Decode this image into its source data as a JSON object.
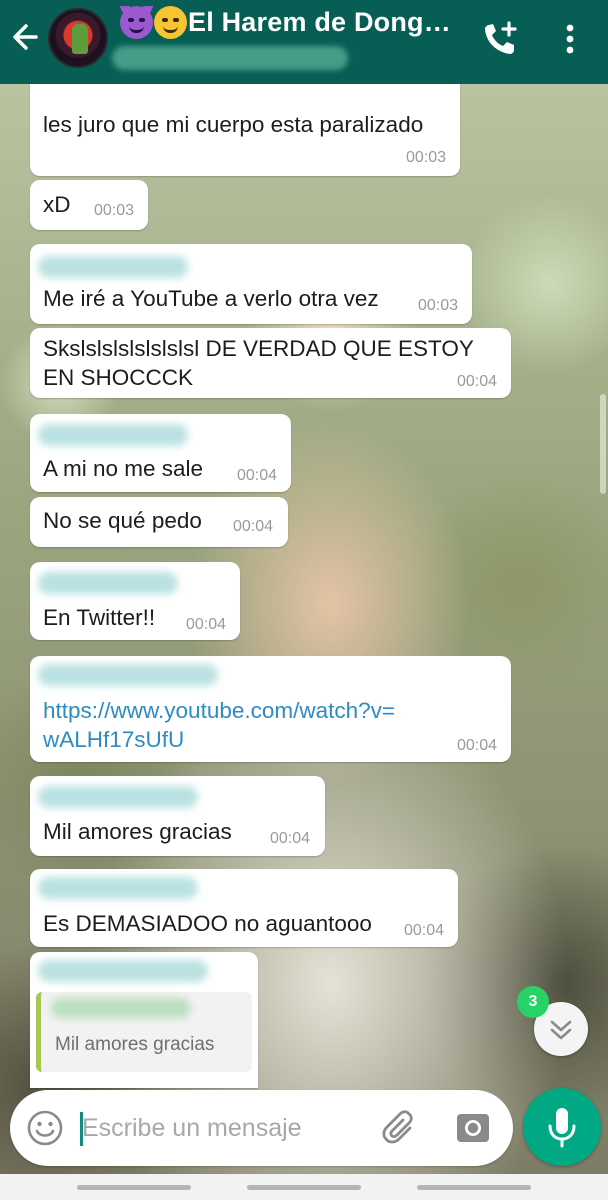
{
  "header": {
    "title": "El Harem de Dong…",
    "title_emojis": [
      "smiling-devil-emoji",
      "drooling-face-emoji"
    ],
    "background_color": "#075e54"
  },
  "messages": [
    {
      "text": "les juro que mi cuerpo esta paralizado",
      "time": "00:03"
    },
    {
      "text": "xD",
      "time": "00:03"
    },
    {
      "text": "Me iré a YouTube a verlo otra vez",
      "time": "00:03"
    },
    {
      "text": "Skslslslslslslslsl DE VERDAD QUE ESTOY\nEN SHOCCCK",
      "time": "00:04"
    },
    {
      "text": "A mi no me sale",
      "time": "00:04"
    },
    {
      "text": "No se qué pedo",
      "time": "00:04"
    },
    {
      "text": "En Twitter!!",
      "time": "00:04"
    },
    {
      "text": "https://www.youtube.com/watch?v=\nwALHf17sUfU",
      "time": "00:04"
    },
    {
      "text": "Mil amores gracias",
      "time": "00:04"
    },
    {
      "text": "Es DEMASIADOO no aguantooo",
      "time": "00:04"
    }
  ],
  "reply_preview": {
    "quoted_text": "Mil amores gracias"
  },
  "scroll_down": {
    "unread_count": "3"
  },
  "composer": {
    "placeholder": "Escribe un mensaje"
  },
  "colors": {
    "accent": "#00a884",
    "link": "#2e8bc3",
    "badge": "#25d366",
    "quote_bar": "#a5c850"
  }
}
